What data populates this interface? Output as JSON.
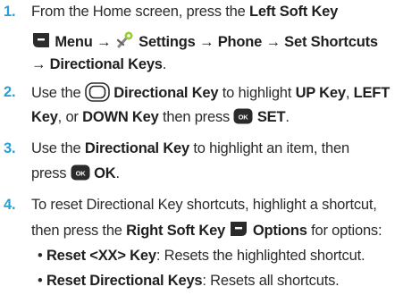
{
  "steps": [
    {
      "num": "1.",
      "lines": [
        [
          "From the Home screen, press the ",
          "Left Soft Key"
        ],
        [
          "Menu → ",
          "Settings → Phone → Set Shortcuts"
        ],
        [
          "→ Directional Keys",
          "."
        ]
      ]
    },
    {
      "num": "2.",
      "lines": [
        [
          "Use the ",
          "Directional Key",
          " to highlight ",
          "UP Key",
          ", ",
          "LEFT"
        ],
        [
          "Key",
          ", or ",
          "DOWN Key",
          " then press ",
          "SET",
          "."
        ]
      ]
    },
    {
      "num": "3.",
      "lines": [
        [
          "Use the ",
          "Directional Key",
          " to highlight an item, then"
        ],
        [
          "press ",
          "OK",
          "."
        ]
      ]
    },
    {
      "num": "4.",
      "lines": [
        [
          "To reset Directional Key shortcuts, highlight a shortcut,"
        ],
        [
          "then press the ",
          "Right Soft Key",
          "Options",
          " for options:"
        ]
      ]
    }
  ],
  "bullets": [
    [
      "Reset <XX> Key",
      ": Resets the highlighted shortcut."
    ],
    [
      "Reset Directional Keys",
      ": Resets all shortcuts."
    ]
  ],
  "icons": {
    "ok_key_label": "OK"
  },
  "colors": {
    "step_number": "#2a9fd6"
  }
}
